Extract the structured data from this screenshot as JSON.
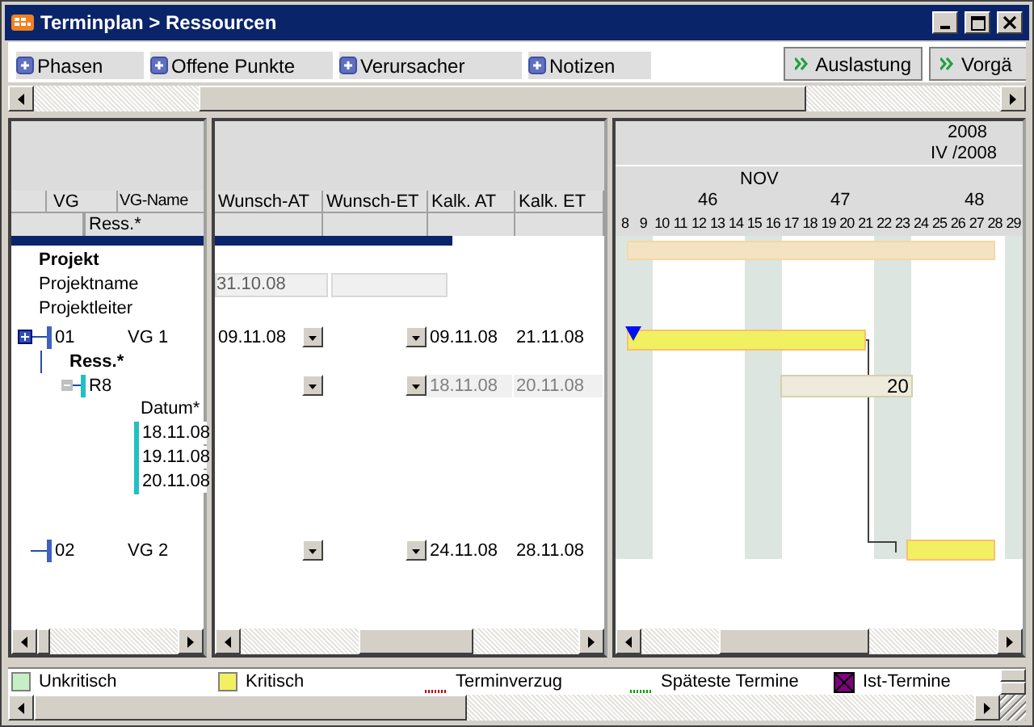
{
  "window": {
    "title": "Terminplan > Ressourcen"
  },
  "toolbar_tabs": [
    {
      "label": "Phasen"
    },
    {
      "label": "Offene Punkte"
    },
    {
      "label": "Verursacher"
    },
    {
      "label": "Notizen"
    }
  ],
  "toolbar_buttons": [
    {
      "label": "Auslastung"
    },
    {
      "label": "Vorgä"
    }
  ],
  "left_columns": [
    "VG",
    "VG-Name"
  ],
  "left_subheader": "Ress.*",
  "middle_columns": [
    "Wunsch-AT",
    "Wunsch-ET",
    "Kalk. AT",
    "Kalk. ET"
  ],
  "project": {
    "heading": "Projekt",
    "fields": [
      {
        "label": "Projektname",
        "value": "31.10.08"
      },
      {
        "label": "Projektleiter"
      }
    ]
  },
  "rows": [
    {
      "kind": "vg",
      "number": "01",
      "name": "VG 1",
      "wunsch_at": "09.11.08",
      "kalk_at": "09.11.08",
      "kalk_et": "21.11.08"
    },
    {
      "kind": "resource",
      "header": "Ress.*",
      "name": "R8",
      "kalk_at": "18.11.08",
      "kalk_et": "20.11.08",
      "dates_header": "Datum*",
      "dates": [
        "18.11.08",
        "19.11.08",
        "20.11.08"
      ]
    },
    {
      "kind": "vg",
      "number": "02",
      "name": "VG 2",
      "kalk_at": "24.11.08",
      "kalk_et": "28.11.08"
    }
  ],
  "timeline": {
    "year": "2008",
    "quarter": "IV /2008",
    "month": "NOV",
    "weeks": [
      "46",
      "47",
      "48"
    ],
    "days": [
      {
        "label": "8",
        "weekend": true
      },
      {
        "label": "9",
        "weekend": true
      },
      {
        "label": "10",
        "weekend": false
      },
      {
        "label": "11",
        "weekend": false
      },
      {
        "label": "12",
        "weekend": false
      },
      {
        "label": "13",
        "weekend": false
      },
      {
        "label": "14",
        "weekend": false
      },
      {
        "label": "15",
        "weekend": true
      },
      {
        "label": "16",
        "weekend": true
      },
      {
        "label": "17",
        "weekend": false
      },
      {
        "label": "18",
        "weekend": false
      },
      {
        "label": "19",
        "weekend": false
      },
      {
        "label": "20",
        "weekend": false
      },
      {
        "label": "21",
        "weekend": false
      },
      {
        "label": "22",
        "weekend": true
      },
      {
        "label": "23",
        "weekend": true
      },
      {
        "label": "24",
        "weekend": false
      },
      {
        "label": "25",
        "weekend": false
      },
      {
        "label": "26",
        "weekend": false
      },
      {
        "label": "27",
        "weekend": false
      },
      {
        "label": "28",
        "weekend": false
      },
      {
        "label": "29",
        "weekend": true
      }
    ]
  },
  "gantt_bars": [
    {
      "kind": "project"
    },
    {
      "kind": "critical"
    },
    {
      "kind": "load",
      "label": "20"
    },
    {
      "kind": "critical"
    }
  ],
  "legend": [
    {
      "label": "Unkritisch",
      "kind": "box",
      "color": "#c6efc6"
    },
    {
      "label": "Kritisch",
      "kind": "box",
      "color": "#f0f060"
    },
    {
      "label": "Terminverzug",
      "kind": "line",
      "color": "#c00000"
    },
    {
      "label": "Späteste Termine",
      "kind": "line",
      "color": "#00a000"
    },
    {
      "label": "Ist-Termine",
      "kind": "cross",
      "color": "#800080"
    }
  ]
}
